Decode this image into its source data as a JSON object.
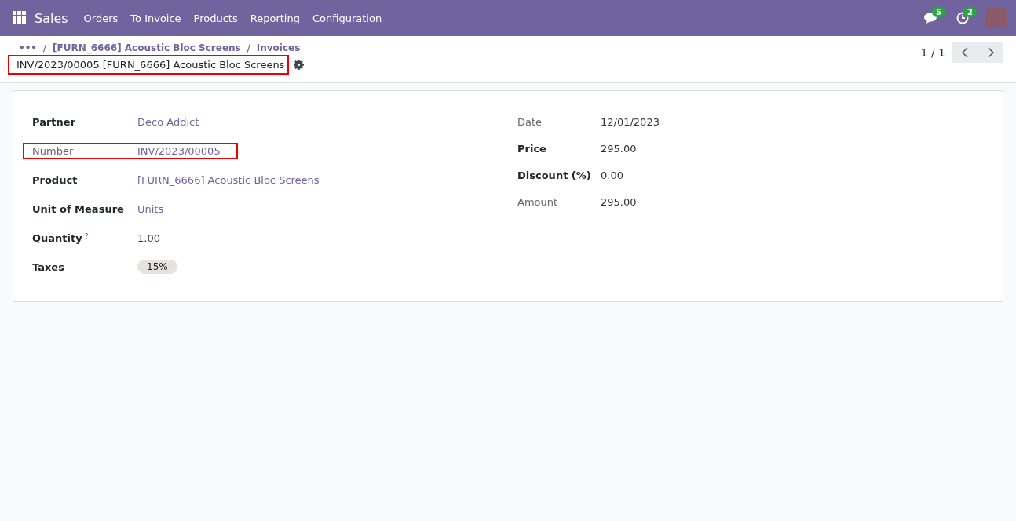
{
  "navbar": {
    "app": "Sales",
    "menu": [
      "Orders",
      "To Invoice",
      "Products",
      "Reporting",
      "Configuration"
    ],
    "messages_count": "5",
    "activities_count": "2"
  },
  "breadcrumb": {
    "ellipsis": "•••",
    "separator": "/",
    "items": [
      "[FURN_6666] Acoustic Bloc Screens",
      "Invoices"
    ],
    "title": "INV/2023/00005 [FURN_6666] Acoustic Bloc Screens",
    "title_highlighted": true
  },
  "pager": {
    "text": "1 / 1"
  },
  "left_fields": [
    {
      "label": "Partner",
      "value": "Deco Addict",
      "kind": "link",
      "readonly": false,
      "highlighted": false
    },
    {
      "label": "Number",
      "value": "INV/2023/00005",
      "kind": "link",
      "readonly": true,
      "highlighted": true
    },
    {
      "label": "Product",
      "value": "[FURN_6666] Acoustic Bloc Screens",
      "kind": "link",
      "readonly": false,
      "highlighted": false
    },
    {
      "label": "Unit of Measure",
      "value": "Units",
      "kind": "link",
      "readonly": false,
      "highlighted": false
    },
    {
      "label": "Quantity",
      "help": "?",
      "value": "1.00",
      "kind": "plain",
      "readonly": false,
      "highlighted": false
    },
    {
      "label": "Taxes",
      "value": "15%",
      "kind": "tag",
      "readonly": false,
      "highlighted": false
    }
  ],
  "right_fields": [
    {
      "label": "Date",
      "value": "12/01/2023",
      "kind": "plain",
      "readonly": true,
      "highlighted": false
    },
    {
      "label": "Price",
      "value": "295.00",
      "kind": "plain",
      "readonly": false,
      "highlighted": false
    },
    {
      "label": "Discount (%)",
      "value": "0.00",
      "kind": "plain",
      "readonly": false,
      "highlighted": false
    },
    {
      "label": "Amount",
      "value": "295.00",
      "kind": "plain",
      "readonly": true,
      "highlighted": false
    }
  ]
}
